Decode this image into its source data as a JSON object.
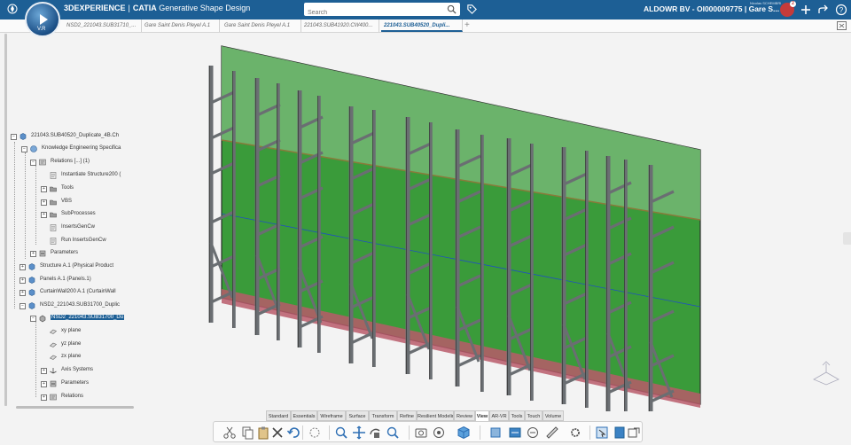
{
  "header": {
    "brand": "3DEXPERIENCE",
    "app": "CATIA",
    "app_module": "Generative Shape Design",
    "compass_version": "V.R",
    "search_placeholder": "Search",
    "company": "ALDOWR BV - OI000009775 | Gare S...",
    "user": "Nicolas SCHEMBRI",
    "notifications": "2",
    "colors": {
      "bar": "#1d5f95",
      "accent_red": "#c53b3b"
    }
  },
  "tabs": [
    {
      "label": "NSD2_221043.SUB31710_..."
    },
    {
      "label": "Gare Saint Denis Pleyel A.1"
    },
    {
      "label": "Gare Saint Denis Pleyel A.1"
    },
    {
      "label": "221043.SUB41920.CW400..."
    },
    {
      "label": "221043.SUB40520_Dupli..."
    }
  ],
  "tree": {
    "nodes": [
      {
        "label": "221043.SUB40520_Duplicate_4B.Ch",
        "icon": "product-icon",
        "expander": "−"
      },
      {
        "label": "Knowledge Engineering Specifica",
        "icon": "knowledge-icon",
        "expander": "−"
      },
      {
        "label": "Relations [...] (1)",
        "icon": "relations-icon",
        "expander": "−"
      },
      {
        "label": "Instantiate Structure200 (",
        "icon": "script-icon",
        "expander": ""
      },
      {
        "label": "Tools",
        "icon": "folder-icon",
        "expander": "+"
      },
      {
        "label": "VBS",
        "icon": "folder-icon",
        "expander": "+"
      },
      {
        "label": "SubProcesses",
        "icon": "folder-icon",
        "expander": "+"
      },
      {
        "label": "InsertsGenCw",
        "icon": "script-icon",
        "expander": ""
      },
      {
        "label": "Run InsertsGenCw",
        "icon": "script-icon",
        "expander": ""
      },
      {
        "label": "Parameters",
        "icon": "parameters-icon",
        "expander": "+"
      },
      {
        "label": "Structure A.1 (Physical Product",
        "icon": "product-icon",
        "expander": "+"
      },
      {
        "label": "Panels A.1 (Panels.1)",
        "icon": "product-icon",
        "expander": "+"
      },
      {
        "label": "CurtainWall200 A.1 (CurtainWall",
        "icon": "product-icon",
        "expander": "+"
      },
      {
        "label": "NSD2_221043.SUB31700_Duplic",
        "icon": "product-icon",
        "expander": "−"
      },
      {
        "label": "NSD2_221043.SUB31700_Du",
        "icon": "part-icon",
        "expander": "−"
      },
      {
        "label": "xy plane",
        "icon": "plane-icon",
        "expander": ""
      },
      {
        "label": "yz plane",
        "icon": "plane-icon",
        "expander": ""
      },
      {
        "label": "zx plane",
        "icon": "plane-icon",
        "expander": ""
      },
      {
        "label": "Axis Systems",
        "icon": "axis-icon",
        "expander": "+"
      },
      {
        "label": "Parameters",
        "icon": "parameters-icon",
        "expander": "+"
      },
      {
        "label": "Relations",
        "icon": "relations-icon",
        "expander": "+"
      }
    ]
  },
  "toolbar_tabs": [
    {
      "label": "Standard"
    },
    {
      "label": "Essentials"
    },
    {
      "label": "Wireframe"
    },
    {
      "label": "Surface"
    },
    {
      "label": "Transform"
    },
    {
      "label": "Refine"
    },
    {
      "label": "Resilient Modeling"
    },
    {
      "label": "Review"
    },
    {
      "label": "View"
    },
    {
      "label": "AR-VR"
    },
    {
      "label": "Tools"
    },
    {
      "label": "Touch"
    },
    {
      "label": "Volume"
    }
  ],
  "action_bar": {
    "icons": [
      "cut-icon",
      "copy-icon",
      "paste-icon",
      "delete-icon",
      "undo-icon",
      "update-icon",
      "zoom-fit-icon",
      "pan-icon",
      "rotate-icon",
      "zoom-icon",
      "capture-icon",
      "render-icon",
      "view-cube-icon",
      "isometric-icon",
      "hide-show-icon",
      "swap-icon",
      "measure-icon",
      "settings-icon",
      "select-icon",
      "properties-icon",
      "share-icon"
    ]
  },
  "model": {
    "panel_color": "#3f9e3f",
    "panel_upper_color": "#6fb56f",
    "mullion_color": "#6a6e72",
    "base_color": "#b85a6a"
  }
}
